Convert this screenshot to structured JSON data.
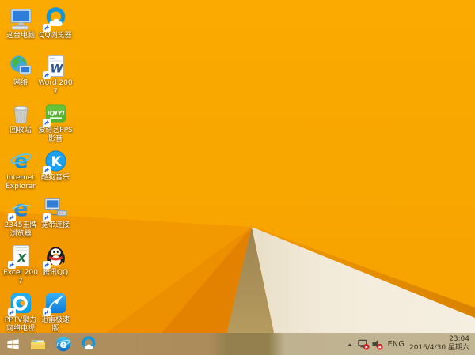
{
  "desktop": {
    "icons": [
      {
        "id": "this-pc",
        "label": "这台电脑"
      },
      {
        "id": "qq-browser",
        "label": "QQ浏览器"
      },
      {
        "id": "network",
        "label": "网络"
      },
      {
        "id": "word-2007",
        "label": "Word 2007"
      },
      {
        "id": "recycle-bin",
        "label": "回收站"
      },
      {
        "id": "iqiyi-pps",
        "label": "爱奇艺PPS影音"
      },
      {
        "id": "internet-explorer",
        "label": "Internet Explorer"
      },
      {
        "id": "kugou-music",
        "label": "酷狗音乐"
      },
      {
        "id": "2345-browser",
        "label": "2345王牌浏览器"
      },
      {
        "id": "broadband",
        "label": "宽带连接"
      },
      {
        "id": "excel-2007",
        "label": "Excel 2007"
      },
      {
        "id": "tencent-qq",
        "label": "腾讯QQ"
      },
      {
        "id": "pptv",
        "label": "PPTV聚力网络电视"
      },
      {
        "id": "xunlei",
        "label": "迅雷极速版"
      }
    ]
  },
  "taskbar": {
    "pinned_icons": [
      "start-icon",
      "file-explorer-icon",
      "internet-explorer-icon",
      "qq-browser-icon"
    ],
    "tray": {
      "expand_icon": "chevron-up-icon",
      "network_status": "disconnected",
      "volume_status": "muted",
      "language": "ENG",
      "time": "23:04",
      "date": "2016/4/30 星期六"
    }
  },
  "colors": {
    "wallpaper_base": "#F8A600",
    "wallpaper_dark_facet": "#E38200",
    "wallpaper_shadow_olive": "#A68C55",
    "wallpaper_cream": "#F3EBDA",
    "taskbar_over_orange": "#AF8F5F",
    "taskbar_over_cream": "#C0B392"
  }
}
